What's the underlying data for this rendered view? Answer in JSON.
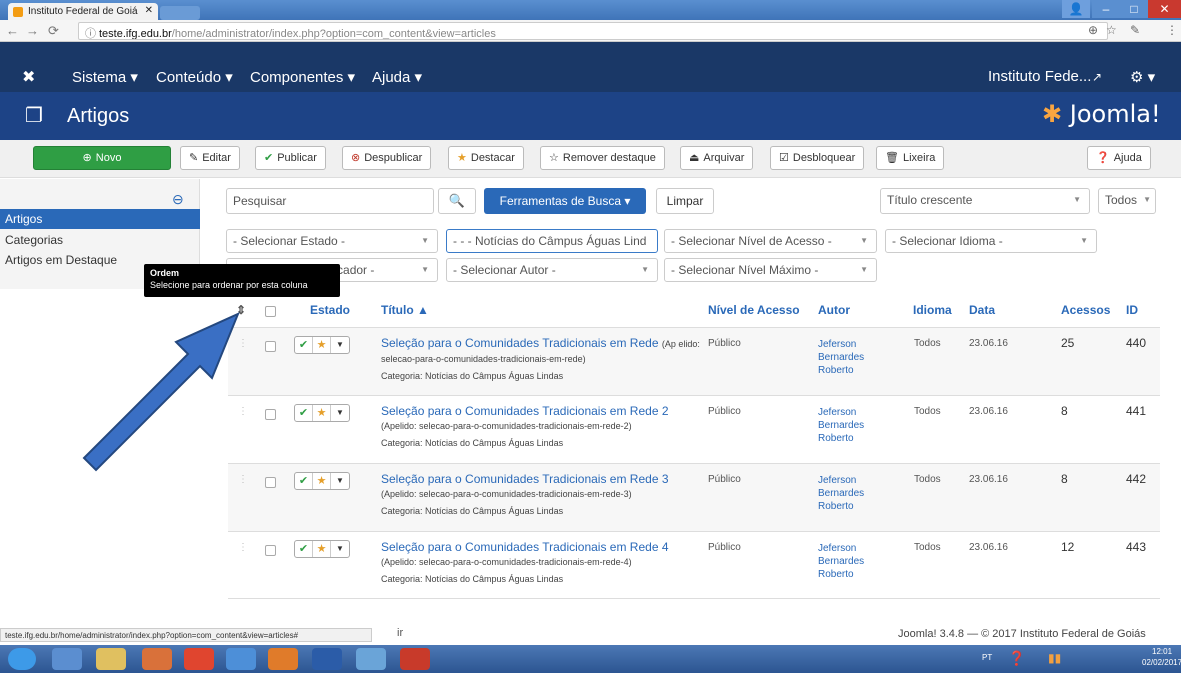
{
  "browser": {
    "tab_title": "Instituto Federal de Goiá",
    "url_host": "teste.ifg.edu.br",
    "url_path": "/home/administrator/index.php?option=com_content&view=articles",
    "status_url": "teste.ifg.edu.br/home/administrator/index.php?option=com_content&view=articles#"
  },
  "navbar": {
    "menus": [
      "Sistema ▾",
      "Conteúdo ▾",
      "Componentes ▾",
      "Ajuda ▾"
    ],
    "site_name": "Instituto Fede...",
    "site_icon": "external-link-icon",
    "settings_label": "⚙ ▾"
  },
  "subhead": {
    "title": "Artigos",
    "brand": "Joomla!"
  },
  "toolbar": {
    "novo": "Novo",
    "editar": "Editar",
    "publicar": "Publicar",
    "despublicar": "Despublicar",
    "destacar": "Destacar",
    "remover_destaque": "Remover destaque",
    "arquivar": "Arquivar",
    "desbloquear": "Desbloquear",
    "lixeira": "Lixeira",
    "ajuda": "Ajuda"
  },
  "sidebar": {
    "items": [
      "Artigos",
      "Categorias",
      "Artigos em Destaque"
    ]
  },
  "tooltip": {
    "title": "Ordem",
    "text": "Selecione para ordenar por esta coluna"
  },
  "search": {
    "placeholder": "Pesquisar",
    "tools_label": "Ferramentas de Busca ▾",
    "clear_label": "Limpar",
    "sort_value": "Título crescente",
    "limit_value": "Todos"
  },
  "filters": {
    "estado": "- Selecionar Estado -",
    "categoria": "- - - Notícias do Câmpus Águas Lind",
    "nivel_acesso": "- Selecionar Nível de Acesso -",
    "idioma": "- Selecionar Idioma -",
    "marcador": "- Selecione um Marcador -",
    "autor": "- Selecionar Autor -",
    "nivel_maximo": "- Selecionar Nível Máximo -"
  },
  "table": {
    "headers": {
      "estado": "Estado",
      "titulo": "Título ▲",
      "nivel_acesso": "Nível de Acesso",
      "autor": "Autor",
      "idioma": "Idioma",
      "data": "Data",
      "acessos": "Acessos",
      "id": "ID"
    },
    "rows": [
      {
        "title": "Seleção para o Comunidades Tradicionais em Rede",
        "alias": "(Ap elido: selecao-para-o-comunidades-tradicionais-em-rede)",
        "category": "Categoria: Notícias do Câmpus Águas Lindas",
        "access": "Público",
        "author": "Jeferson Bernardes Roberto",
        "language": "Todos",
        "date": "23.06.16",
        "hits": "25",
        "id": "440"
      },
      {
        "title": "Seleção para o Comunidades Tradicionais em Rede 2",
        "alias": "(Apelido: selecao-para-o-comunidades-tradicionais-em-rede-2)",
        "category": "Categoria: Notícias do Câmpus Águas Lindas",
        "access": "Público",
        "author": "Jeferson Bernardes Roberto",
        "language": "Todos",
        "date": "23.06.16",
        "hits": "8",
        "id": "441"
      },
      {
        "title": "Seleção para o Comunidades Tradicionais em Rede 3",
        "alias": "(Apelido: selecao-para-o-comunidades-tradicionais-em-rede-3)",
        "category": "Categoria: Notícias do Câmpus Águas Lindas",
        "access": "Público",
        "author": "Jeferson Bernardes Roberto",
        "language": "Todos",
        "date": "23.06.16",
        "hits": "8",
        "id": "442"
      },
      {
        "title": "Seleção para o Comunidades Tradicionais em Rede 4",
        "alias": "(Apelido: selecao-para-o-comunidades-tradicionais-em-rede-4)",
        "category": "Categoria: Notícias do Câmpus Águas Lindas",
        "access": "Público",
        "author": "Jeferson Bernardes Roberto",
        "language": "Todos",
        "date": "23.06.16",
        "hits": "12",
        "id": "443"
      }
    ]
  },
  "footer": {
    "text": "Joomla! 3.4.8 — © 2017 Instituto Federal de Goiás",
    "partial_link": "ir"
  },
  "taskbar": {
    "lang": "PT",
    "time": "12:01",
    "date": "02/02/2017"
  },
  "colors": {
    "navbar": "#1a3867",
    "subhead": "#1d4386",
    "primary": "#2a69b8",
    "success": "#2f9e44",
    "arrow": "#3a6fc4"
  }
}
